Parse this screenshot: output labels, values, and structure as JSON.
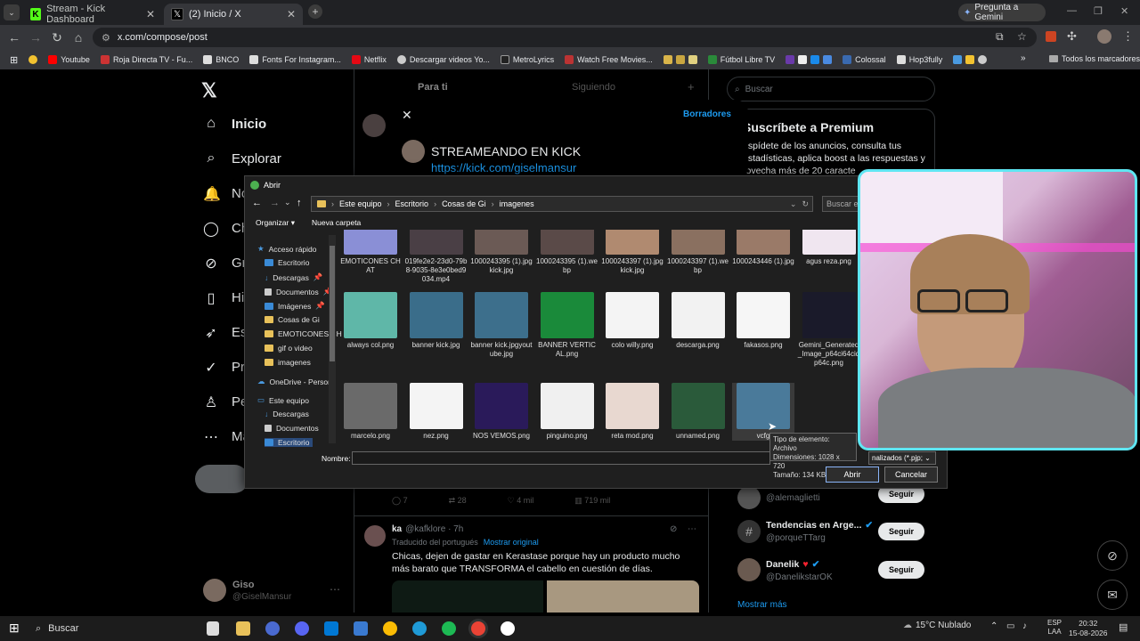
{
  "browser": {
    "tabs": [
      {
        "title": "Stream - Kick Dashboard",
        "active": false
      },
      {
        "title": "(2) Inicio / X",
        "active": true
      }
    ],
    "gemini_button": "Pregunta a Gemini",
    "url": "x.com/compose/post",
    "bookmarks": [
      "Youtube",
      "Roja Directa TV - Fu...",
      "BNCO",
      "Fonts For Instagram...",
      "Netflix",
      "Descargar videos Yo...",
      "MetroLyrics",
      "Watch Free Movies...",
      "Fútbol Libre TV",
      "Colossal",
      "Hop3fully"
    ],
    "all_bookmarks": "Todos los marcadores"
  },
  "x": {
    "nav": [
      "Inicio",
      "Explorar",
      "No",
      "Ch",
      "Gr",
      "Hi",
      "Es",
      "Pre",
      "Pe",
      "Má"
    ],
    "feed_tabs": [
      "Para ti",
      "Siguiendo"
    ],
    "search_placeholder": "Buscar",
    "premium_title": "Suscríbete a Premium",
    "premium_text": "espídete de los anuncios, consulta tus estadísticas, aplica boost a las respuestas y rovecha más de 20 caracte",
    "compose": {
      "drafts": "Borradores",
      "text_line1": "STREAMEANDO EN KICK",
      "text_line2": "https://kick.com/giselmansur"
    },
    "post_stats": [
      "7",
      "28",
      "4 mil",
      "719 mil"
    ],
    "tweet": {
      "author": "ka",
      "handle": "@kafklore · 7h",
      "translated": "Traducido del portugués",
      "show_original": "Mostrar original",
      "text": "Chicas, dejen de gastar en Kerastase porque hay un producto mucho más barato que TRANSFORMA el cabello en cuestión de días."
    },
    "suggestions": [
      {
        "name": "",
        "handle": "@alemaglietti",
        "button": "Seguir"
      },
      {
        "name": "Tendencias en Arge...",
        "handle": "@porqueTTarg",
        "button": "Seguir"
      },
      {
        "name": "Danelik",
        "handle": "@DanelikstarOK",
        "button": "Seguir"
      }
    ],
    "show_more": "Mostrar más",
    "profile_name": "Giso",
    "profile_handle": "@GiselMansur"
  },
  "dialog": {
    "title": "Abrir",
    "breadcrumb": [
      "Este equipo",
      "Escritorio",
      "Cosas de Gi",
      "imagenes"
    ],
    "search_placeholder": "Buscar en",
    "organize": "Organizar",
    "new_folder": "Nueva carpeta",
    "sidebar": [
      "Acceso rápido",
      "Escritorio",
      "Descargas",
      "Documentos",
      "Imágenes",
      "Cosas de Gi",
      "EMOTICONES CH",
      "gif o video",
      "imagenes",
      "OneDrive - Person",
      "Este equipo",
      "Descargas",
      "Documentos",
      "Escritorio"
    ],
    "files": [
      {
        "name": "EMOTICONES CHAT",
        "color": "#8a8fd6"
      },
      {
        "name": "019fe2e2-23d0-79b8-9035-8e3e0bed9034.mp4",
        "color": "#4a3f45"
      },
      {
        "name": "1000243395 (1).jpgkick.jpg",
        "color": "#6b5a55"
      },
      {
        "name": "1000243395 (1).webp",
        "color": "#5a4a48"
      },
      {
        "name": "1000243397 (1).jpgkick.jpg",
        "color": "#b08a70"
      },
      {
        "name": "1000243397 (1).webp",
        "color": "#8a7060"
      },
      {
        "name": "1000243446 (1).jpg",
        "color": "#9a7a68"
      },
      {
        "name": "agus reza.png",
        "color": "#f0e6f0"
      },
      {
        "name": "always col.png",
        "color": "#5fb7a8"
      },
      {
        "name": "banner kick.jpg",
        "color": "#3a6d8a"
      },
      {
        "name": "banner kick.jpgyoutube.jpg",
        "color": "#3d6f8c"
      },
      {
        "name": "BANNER VERTICAL.png",
        "color": "#1a8a3a"
      },
      {
        "name": "colo willy.png",
        "color": "#f4f4f4"
      },
      {
        "name": "descarga.png",
        "color": "#f2f2f2"
      },
      {
        "name": "fakasos.png",
        "color": "#f6f6f6"
      },
      {
        "name": "Gemini_Generated_Image_p64ci64ciqp64c.png",
        "color": "#1a1a2a"
      },
      {
        "name": "marcelo.png",
        "color": "#6a6a6a"
      },
      {
        "name": "nez.png",
        "color": "#f4f4f4"
      },
      {
        "name": "NOS VEMOS.png",
        "color": "#2a1a5a"
      },
      {
        "name": "pinguino.png",
        "color": "#f0f0f0"
      },
      {
        "name": "reta mod.png",
        "color": "#e8d8d0"
      },
      {
        "name": "unnamed.png",
        "color": "#2a5a3a"
      },
      {
        "name": "vcfg",
        "color": "#4a7a9a"
      }
    ],
    "tooltip": [
      "Tipo de elemento: Archivo",
      "Dimensiones: 1028 x 720",
      "Tamaño: 134 KB"
    ],
    "name_label": "Nombre:",
    "filter": "nalizados (*.pjp;",
    "open_button": "Abrir",
    "cancel_button": "Cancelar"
  },
  "taskbar": {
    "search": "Buscar",
    "weather": "15°C Nublado",
    "lang": [
      "ESP",
      "LAA"
    ],
    "time": "20:32",
    "date": "15-08-2026"
  }
}
